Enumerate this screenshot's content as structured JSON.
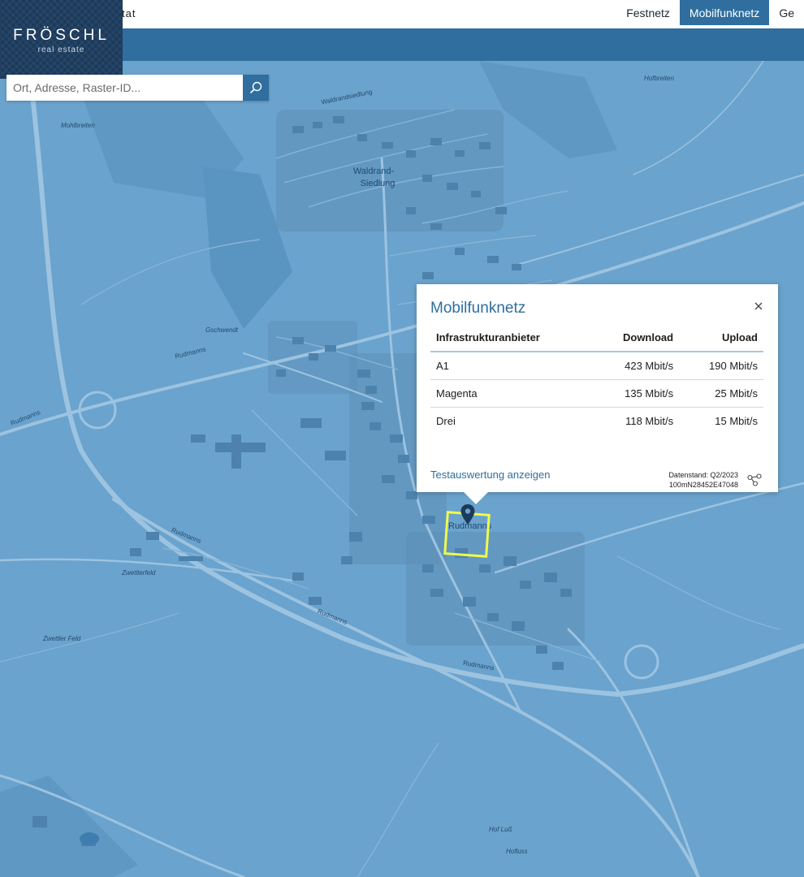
{
  "header": {
    "hidden_title": "tat",
    "tabs": [
      {
        "label": "Festnetz",
        "active": false
      },
      {
        "label": "Mobilfunknetz",
        "active": true
      },
      {
        "label": "Ge",
        "active": false
      }
    ]
  },
  "logo": {
    "brand": "FRÖSCHL",
    "sub": "real estate"
  },
  "search": {
    "placeholder": "Ort, Adresse, Raster-ID..."
  },
  "map": {
    "labels": {
      "hofbreiten": "Hofbreiten",
      "mohlbreiten": "Mohlbreiten",
      "waldrand": "Waldrand-",
      "siedlung": "Siedlung",
      "gschwendt": "Gschwendt",
      "rudmanns": "Rudmanns",
      "zwettlerfeld1": "Zwettlerfeld",
      "zwettlerfeld2": "Zwettler Feld",
      "hofluss1": "Hof Luß",
      "hofluss2": "Hofluss",
      "waldrandsiedlung": "Waldrandsiedlung"
    }
  },
  "popup": {
    "title": "Mobilfunknetz",
    "columns": [
      "Infrastrukturanbieter",
      "Download",
      "Upload"
    ],
    "rows": [
      {
        "provider": "A1",
        "download": "423 Mbit/s",
        "upload": "190 Mbit/s"
      },
      {
        "provider": "Magenta",
        "download": "135 Mbit/s",
        "upload": "25 Mbit/s"
      },
      {
        "provider": "Drei",
        "download": "118 Mbit/s",
        "upload": "15 Mbit/s"
      }
    ],
    "link": "Testauswertung anzeigen",
    "datenstand": "Datenstand: Q2/2023",
    "raster_id": "100mN28452E47048"
  },
  "colors": {
    "accent": "#2f6e9e",
    "map_tint": "#6aa3cd",
    "cell_outline": "#f2f94a"
  }
}
